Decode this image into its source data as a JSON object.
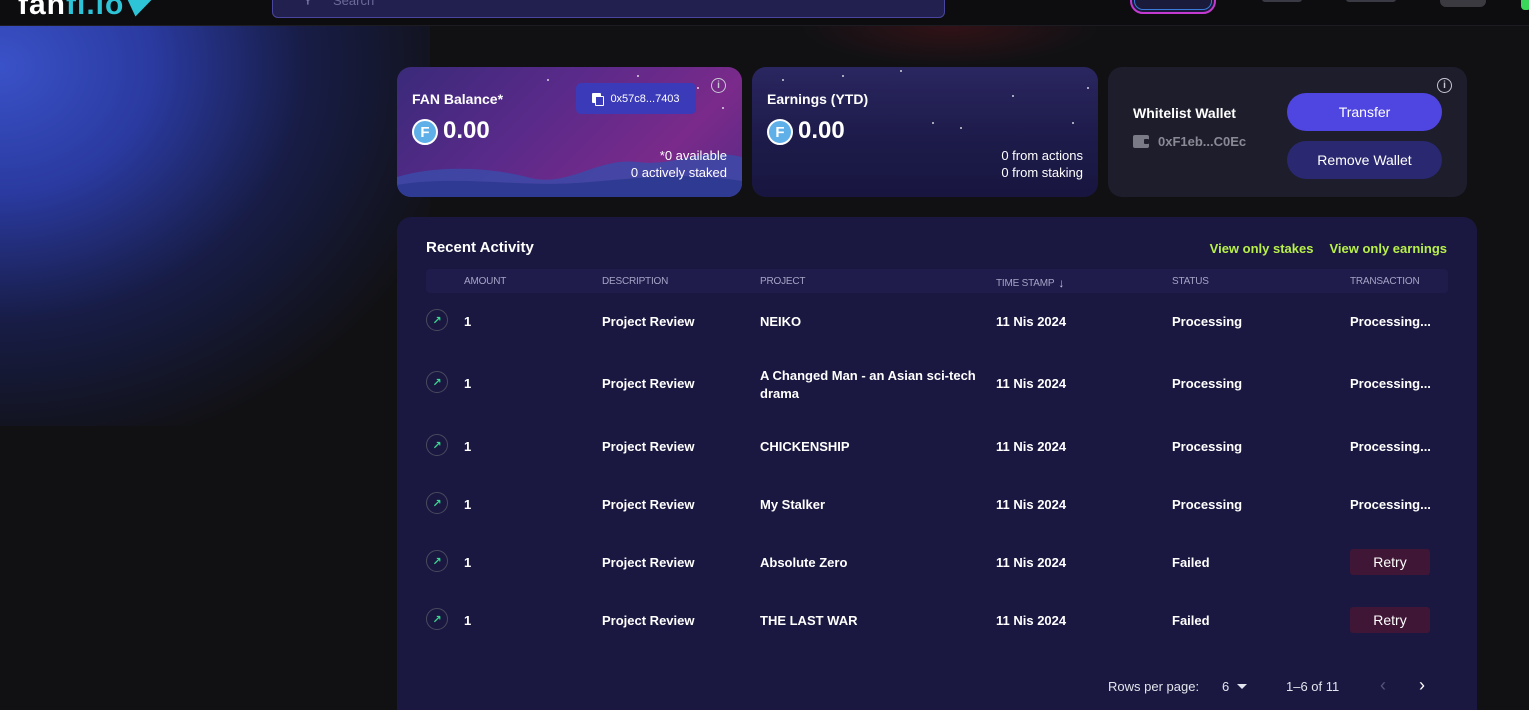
{
  "header": {
    "logo_text": "fan",
    "logo_accent": "fi.io",
    "search_placeholder": "Search"
  },
  "fan_card": {
    "title": "FAN Balance*",
    "amount": "0.00",
    "address": "0x57c8...7403",
    "available": "*0 available",
    "staked": "0 actively staked",
    "coin_letter": "F"
  },
  "earnings_card": {
    "title": "Earnings (YTD)",
    "amount": "0.00",
    "from_actions": "0 from actions",
    "from_staking": "0 from staking",
    "coin_letter": "F"
  },
  "wallet_card": {
    "title": "Whitelist Wallet",
    "address": "0xF1eb...C0Ec",
    "transfer_label": "Transfer",
    "remove_label": "Remove Wallet"
  },
  "activity": {
    "title": "Recent Activity",
    "filter_stakes": "View only stakes",
    "filter_earnings": "View only earnings",
    "columns": {
      "amount": "AMOUNT",
      "description": "DESCRIPTION",
      "project": "PROJECT",
      "timestamp": "TIME STAMP",
      "status": "STATUS",
      "transaction": "TRANSACTION"
    },
    "rows": [
      {
        "amount": "1",
        "description": "Project Review",
        "project": "NEIKO",
        "timestamp": "11 Nis 2024",
        "status": "Processing",
        "transaction": "Processing..."
      },
      {
        "amount": "1",
        "description": "Project Review",
        "project": "A Changed Man - an Asian sci-tech drama",
        "timestamp": "11 Nis 2024",
        "status": "Processing",
        "transaction": "Processing..."
      },
      {
        "amount": "1",
        "description": "Project Review",
        "project": "CHICKENSHIP",
        "timestamp": "11 Nis 2024",
        "status": "Processing",
        "transaction": "Processing..."
      },
      {
        "amount": "1",
        "description": "Project Review",
        "project": "My Stalker",
        "timestamp": "11 Nis 2024",
        "status": "Processing",
        "transaction": "Processing..."
      },
      {
        "amount": "1",
        "description": "Project Review",
        "project": "Absolute Zero",
        "timestamp": "11 Nis 2024",
        "status": "Failed",
        "transaction": "Retry"
      },
      {
        "amount": "1",
        "description": "Project Review",
        "project": "THE LAST WAR",
        "timestamp": "11 Nis 2024",
        "status": "Failed",
        "transaction": "Retry"
      }
    ],
    "pagination": {
      "rows_per_page_label": "Rows per page:",
      "rows_per_page": "6",
      "range": "1–6 of 11"
    }
  },
  "colors": {
    "accent_green": "#b8f04a",
    "primary_button": "#4f45e0",
    "panel_bg": "#1a1840",
    "retry_bg": "#3f1636"
  }
}
